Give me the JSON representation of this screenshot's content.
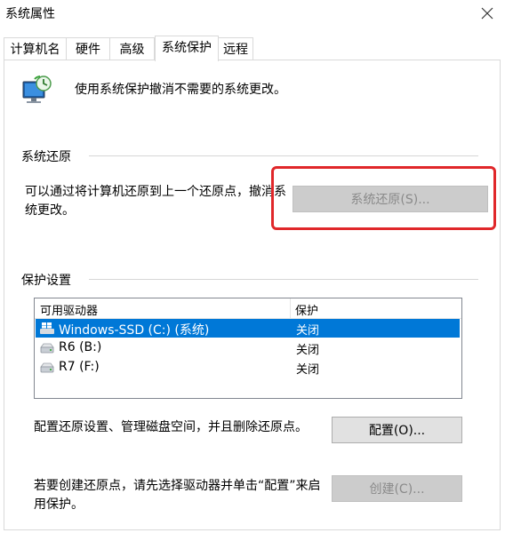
{
  "window": {
    "title": "系统属性"
  },
  "tabs": [
    {
      "label": "计算机名"
    },
    {
      "label": "硬件"
    },
    {
      "label": "高级"
    },
    {
      "label": "系统保护"
    },
    {
      "label": "远程"
    }
  ],
  "header": {
    "text": "使用系统保护撤消不需要的系统更改。"
  },
  "restore": {
    "group_label": "系统还原",
    "description_line1": "可以通过将计算机还原到上一个还原点，撤消系",
    "description_line2": "统更改。",
    "button_label": "系统还原(S)..."
  },
  "protection": {
    "group_label": "保护设置",
    "columns": {
      "drive": "可用驱动器",
      "protection": "保护"
    },
    "drives": [
      {
        "name": "Windows-SSD (C:) (系统)",
        "status": "关闭",
        "selected": true,
        "icon": "windows-drive-icon"
      },
      {
        "name": "R6 (B:)",
        "status": "关闭",
        "selected": false,
        "icon": "drive-icon"
      },
      {
        "name": "R7 (F:)",
        "status": "关闭",
        "selected": false,
        "icon": "drive-icon"
      }
    ],
    "configure_text": "配置还原设置、管理磁盘空间，并且删除还原点。",
    "configure_button": "配置(O)...",
    "create_text_line1": "若要创建还原点，请先选择驱动器并单击“配置”来启",
    "create_text_line2": "用保护。",
    "create_button": "创建(C)..."
  },
  "colors": {
    "selection": "#0078d7",
    "highlight": "#e0272a"
  }
}
